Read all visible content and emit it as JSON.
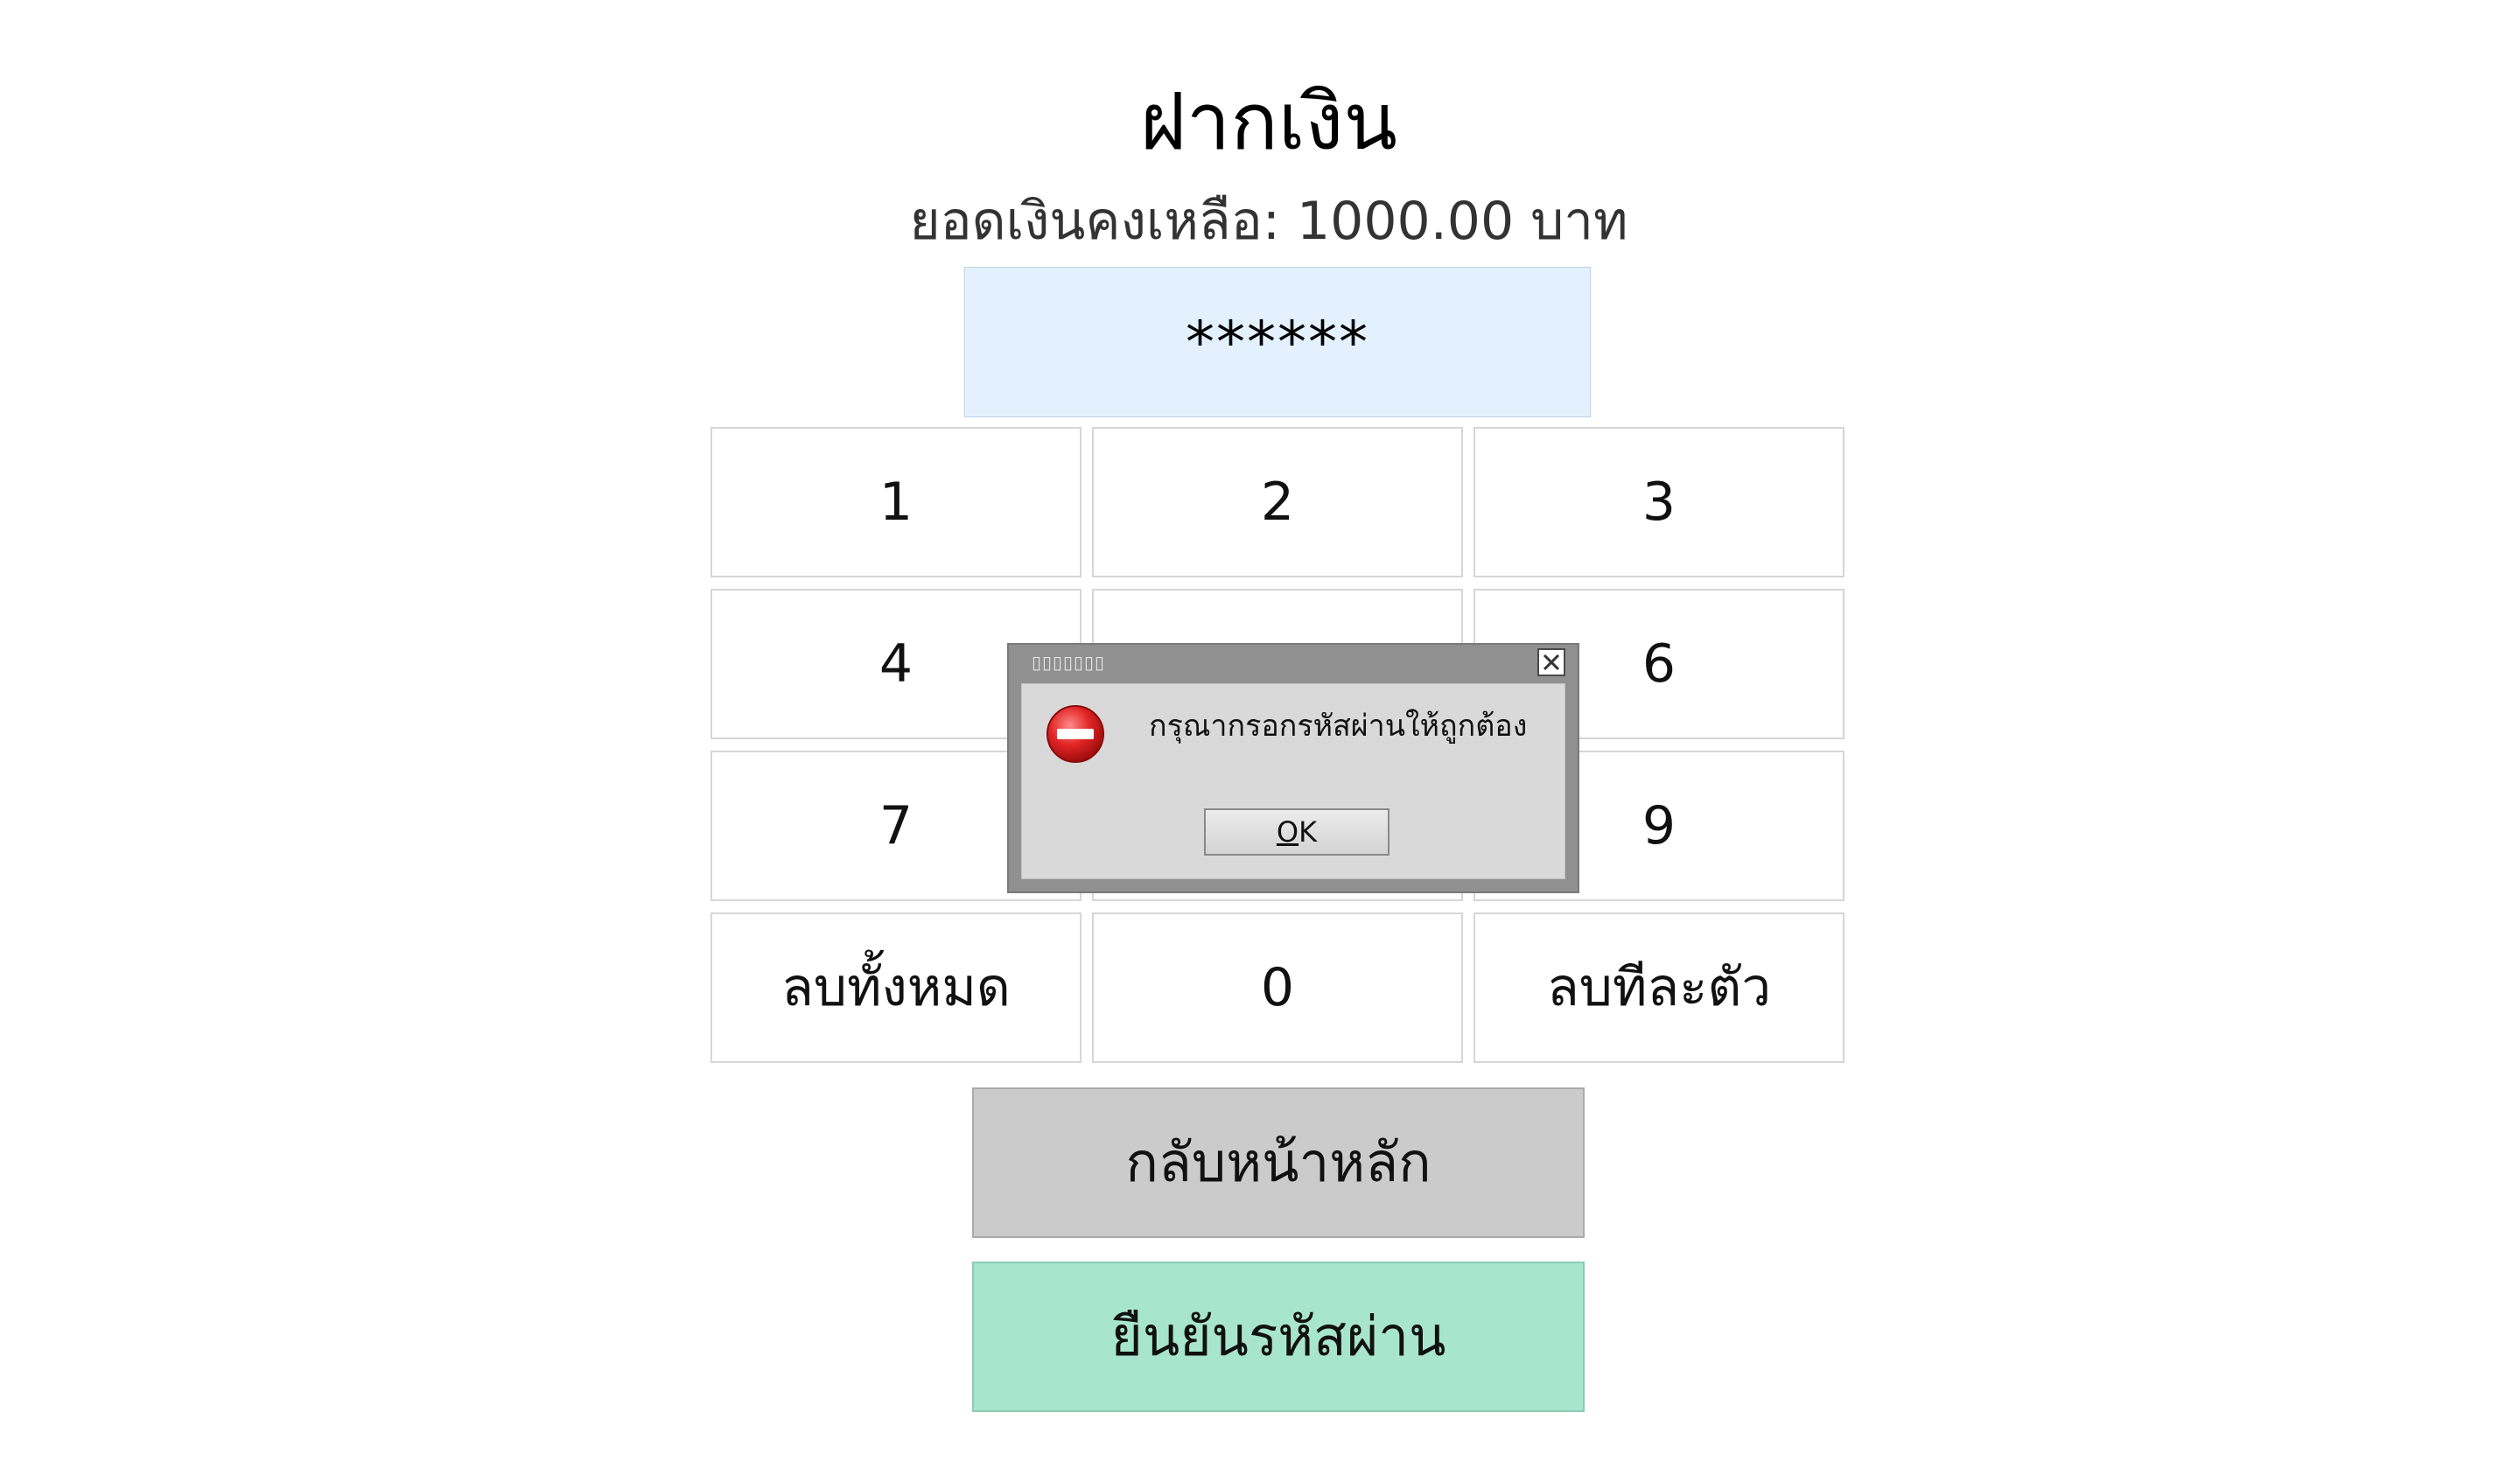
{
  "header": {
    "title": "ฝากเงิน",
    "balance": "ยอดเงินคงเหลือ: 1000.00 บาท"
  },
  "pin": {
    "masked_value": "******"
  },
  "keypad": {
    "k1": "1",
    "k2": "2",
    "k3": "3",
    "k4": "4",
    "k6": "6",
    "k7": "7",
    "k9": "9",
    "clear_all": "ลบทั้งหมด",
    "k0": "0",
    "backspace": "ลบทีละตัว"
  },
  "actions": {
    "home": "กลับหน้าหลัก",
    "confirm": "ยืนยันรหัสผ่าน"
  },
  "colors": {
    "pin_background": "#e3f1ff",
    "home_button": "#cbcbcb",
    "confirm_button": "#a7e5cf",
    "error_icon": "#d62828"
  },
  "dialog": {
    "title": "▯▯▯▯▯▯▯",
    "icon": "error-stop-icon",
    "message": "กรุณากรอกรหัสผ่านให้ถูกต้อง",
    "ok_label_mnemonic": "O",
    "ok_label_rest": "K"
  }
}
